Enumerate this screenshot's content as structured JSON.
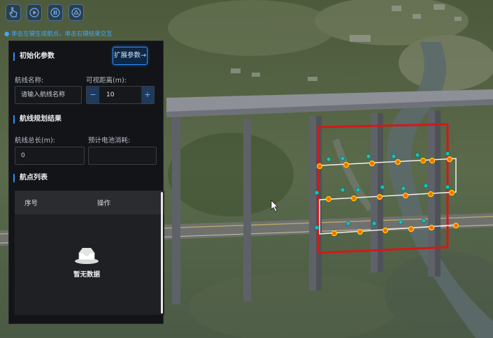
{
  "toolbar": {
    "buttons": [
      {
        "icon": "hand-pointer-icon"
      },
      {
        "icon": "play-icon"
      },
      {
        "icon": "pause-icon"
      },
      {
        "icon": "drone-icon"
      }
    ],
    "hint": "● 单击左键生成航点，单击右键结束交互"
  },
  "panel": {
    "init_section": "初始化参数",
    "expand_button": "扩展参数→",
    "route_name_label": "航线名称:",
    "route_name_placeholder": "请输入航线名称",
    "visible_distance_label": "可视距离(m):",
    "visible_distance_value": "10",
    "minus": "−",
    "plus": "+",
    "result_section": "航线规划结果",
    "route_length_label": "航线总长(m):",
    "route_length_value": "0",
    "battery_label": "预计电池消耗:",
    "battery_value": "",
    "waypoint_section": "航点列表",
    "table": {
      "columns": [
        "序号",
        "操作"
      ],
      "rows": [],
      "empty_text": "暂无数据"
    }
  },
  "colors": {
    "accent": "#2b8cff",
    "panel_bg": "#121417",
    "route_box": "#d41818",
    "waypoint": "#ff6a00"
  }
}
